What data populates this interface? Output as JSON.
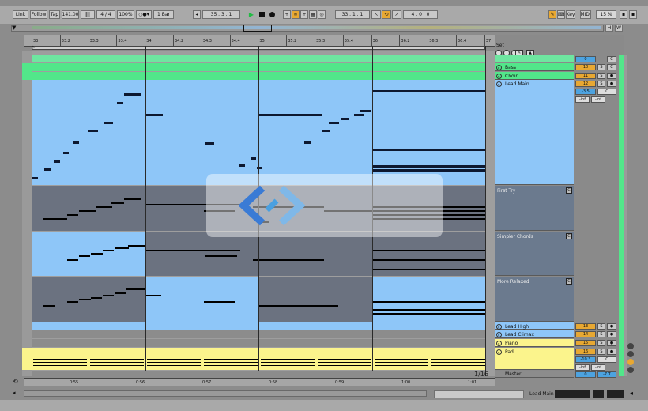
{
  "transport": {
    "link": "Link",
    "follow": "Follow",
    "tap": "Tap",
    "tempo": "141.00",
    "signature_num": "4",
    "signature_den": "4",
    "zoom": "100%",
    "quantize": "1 Bar",
    "position": "35 .  3 .  1",
    "loop_start": "33 .  1 .  1",
    "loop_length": "4 .  0 .  0",
    "key": "Key",
    "midi": "MIDI",
    "cpu": "15 %"
  },
  "ruler": {
    "bars": [
      "33",
      "33.2",
      "33.3",
      "33.4",
      "34",
      "34.2",
      "34.3",
      "34.4",
      "35",
      "35.2",
      "35.3",
      "35.4",
      "36",
      "36.2",
      "36.3",
      "36.4",
      "37"
    ],
    "times": [
      "0:55",
      "0:56",
      "0:57",
      "0:58",
      "0:59",
      "1:00",
      "1:01"
    ]
  },
  "set_label": "Set",
  "tracks": [
    {
      "name": "Bass",
      "num": "10",
      "solo": "S",
      "mono": "C"
    },
    {
      "name": "Choir",
      "num": "11",
      "solo": "S",
      "mono": "●"
    },
    {
      "name": "Lead Main",
      "num": "12",
      "solo": "S",
      "mono": "●",
      "vol": "-3.5",
      "pan": "C",
      "inf1": "-inf",
      "inf2": "-inf"
    },
    {
      "name": "Lead High",
      "num": "13",
      "solo": "S",
      "mono": "●"
    },
    {
      "name": "Lead Climax",
      "num": "14",
      "solo": "S",
      "mono": "●"
    },
    {
      "name": "Piano",
      "num": "15",
      "solo": "S",
      "mono": "●"
    },
    {
      "name": "Pad",
      "num": "16",
      "solo": "S",
      "mono": "●",
      "vol": "-10.3",
      "pan": "C",
      "inf1": "-inf",
      "inf2": "-inf"
    }
  ],
  "top_track": {
    "num": "0",
    "mono": "C"
  },
  "takes": [
    {
      "name": "First Try",
      "btn": "C"
    },
    {
      "name": "Simpler Chords",
      "btn": "C"
    },
    {
      "name": "More Relaxed",
      "btn": "C"
    }
  ],
  "master": {
    "name": "Master",
    "num": "0",
    "val": "-7.7"
  },
  "zoom_page": "1/16",
  "footer_track": "Lead Main",
  "colors": {
    "clip_blue": "#8ec6f8",
    "take_gray": "#6b7280",
    "green": "#52e68a",
    "yellow": "#fbf48c",
    "orange": "#e8a832"
  }
}
